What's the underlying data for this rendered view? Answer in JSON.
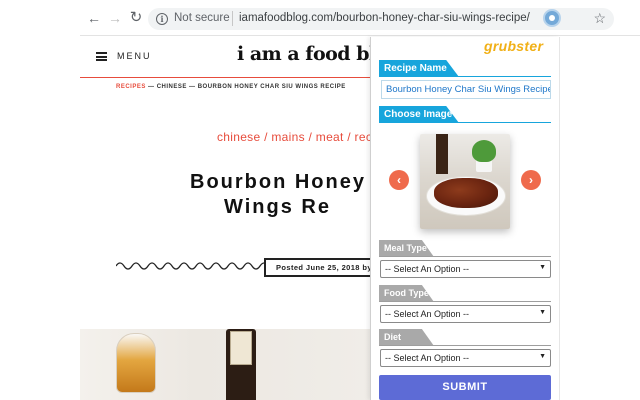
{
  "browser": {
    "security_label": "Not secure",
    "url": "iamafoodblog.com/bourbon-honey-char-siu-wings-recipe/",
    "icons": {
      "back": "back-arrow-icon",
      "forward": "forward-arrow-icon",
      "reload": "reload-icon",
      "info": "info-icon",
      "star": "star-icon",
      "extension": "grubster-extension-icon"
    }
  },
  "site": {
    "menu_label": "MENU",
    "logo": "i am a food blog",
    "breadcrumb": {
      "link": "RECIPES",
      "separator1": " — ",
      "category": "CHINESE",
      "separator2": " — ",
      "current": "BOURBON HONEY CHAR SIU WINGS RECIPE"
    },
    "categories": "chinese / mains / meat / recipes",
    "title_line1": "Bourbon Honey",
    "title_line2": "Wings Re",
    "posted": "Posted June 25, 2018 by",
    "accent_color": "#e74c3c"
  },
  "extension": {
    "brand": "grubster",
    "recipe_name_heading": "Recipe Name",
    "recipe_name_value": "Bourbon Honey Char Siu Wings Recipe",
    "choose_image_heading": "Choose Image",
    "prev_label": "‹",
    "next_label": "›",
    "meal_type_heading": "Meal Type",
    "meal_type_value": "-- Select An Option --",
    "food_type_heading": "Food Type",
    "food_type_value": "-- Select An Option --",
    "diet_heading": "Diet",
    "diet_value": "-- Select An Option --",
    "submit_label": "SUBMIT",
    "colors": {
      "section_blue": "#17a5dc",
      "section_grey": "#a9a9a9",
      "arrow": "#ef6a4c",
      "submit": "#5d6bd6",
      "brand": "#f1b017"
    }
  }
}
